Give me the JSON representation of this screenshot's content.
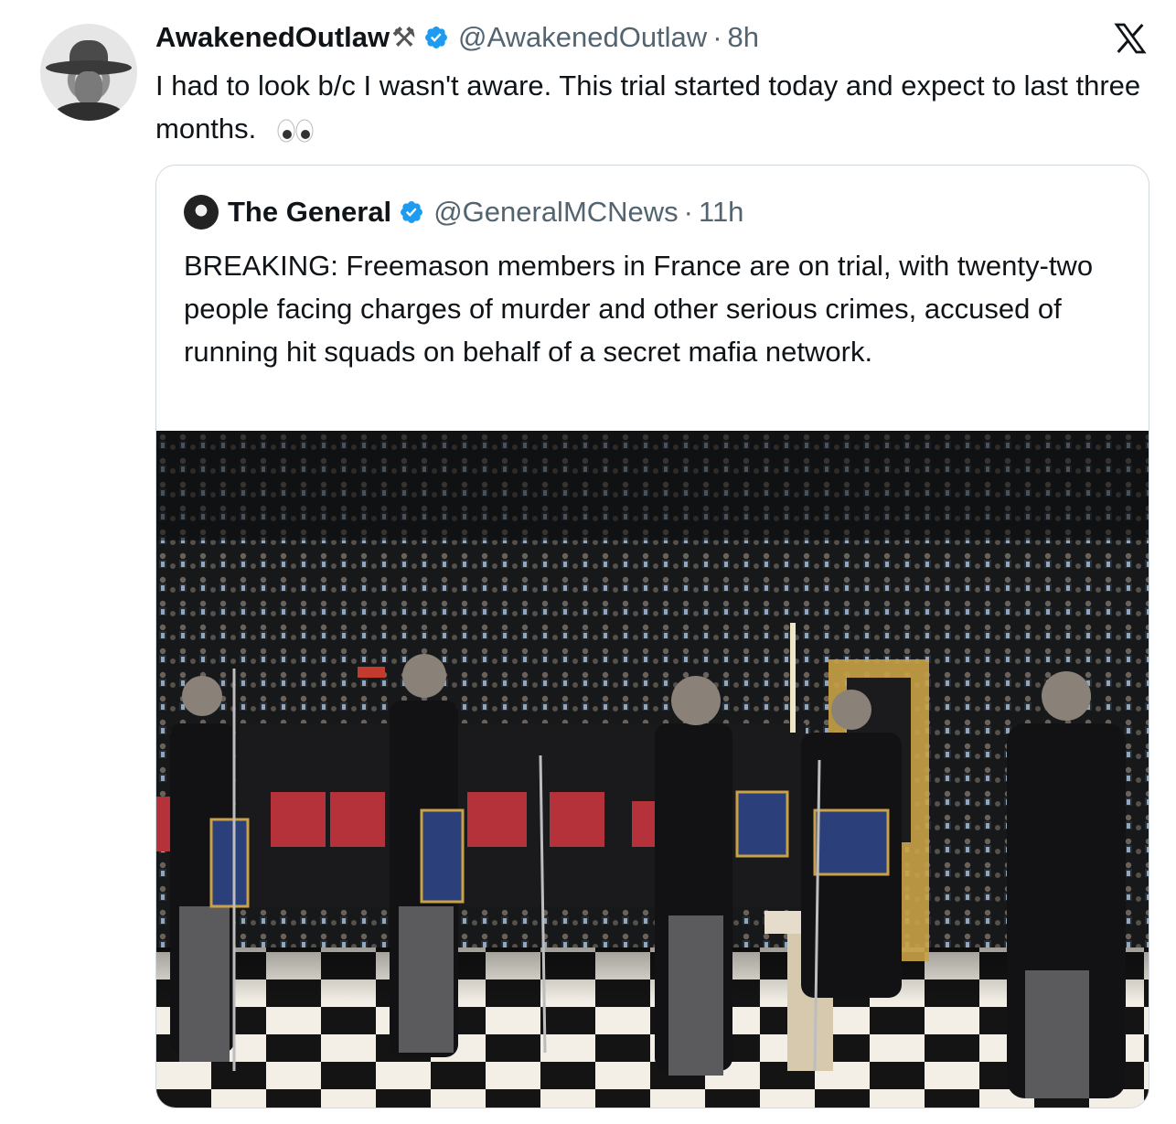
{
  "tweet": {
    "display_name": "AwakenedOutlaw",
    "name_emoji": "⚒",
    "handle": "@AwakenedOutlaw",
    "separator": "·",
    "time": "8h",
    "text": "I had to look b/c I wasn't aware.  This trial started today and expect to last three months.",
    "text_emoji": "eyes"
  },
  "quoted": {
    "display_name": "The General",
    "handle": "@GeneralMCNews",
    "separator": "·",
    "time": "11h",
    "text": "BREAKING: Freemason members in France are on trial, with twenty-two people facing charges of murder and other serious crimes, accused of running hit squads on behalf of a secret mafia network."
  },
  "icons": {
    "verified": "verified-badge-icon",
    "platform": "x-logo-icon"
  },
  "colors": {
    "verified": "#1d9bf0",
    "secondary_text": "#536471",
    "border": "#cfd9de"
  }
}
